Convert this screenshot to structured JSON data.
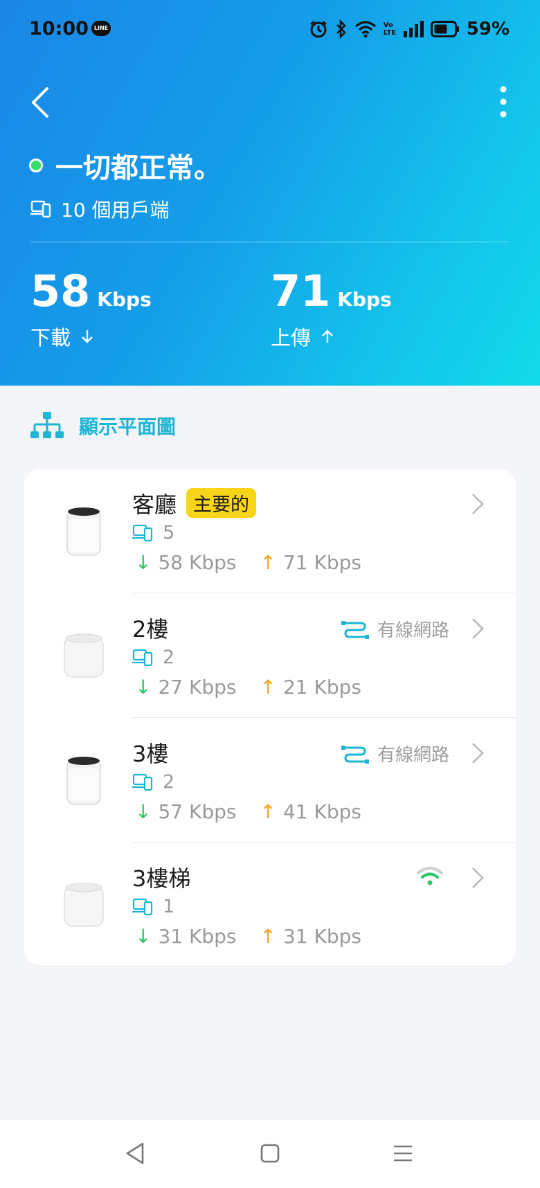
{
  "status_bar": {
    "time": "10:00",
    "line_label": "LINE",
    "volte_label": "Vo LTE",
    "battery_percent": "59%",
    "icons": [
      "line-app-icon",
      "alarm-icon",
      "bluetooth-icon",
      "wifi-icon",
      "volte-icon",
      "signal-icon",
      "battery-icon"
    ]
  },
  "header": {
    "status_message": "一切都正常。",
    "clients": "10 個用戶端",
    "download": {
      "value": "58",
      "unit": "Kbps",
      "label": "下載"
    },
    "upload": {
      "value": "71",
      "unit": "Kbps",
      "label": "上傳"
    }
  },
  "floor_plan": {
    "label": "顯示平面圖"
  },
  "devices": [
    {
      "name": "客廳",
      "badge": "主要的",
      "clients": "5",
      "down": "58 Kbps",
      "up": "71 Kbps",
      "connection": ""
    },
    {
      "name": "2樓",
      "clients": "2",
      "down": "27 Kbps",
      "up": "21 Kbps",
      "connection": "有線網路"
    },
    {
      "name": "3樓",
      "clients": "2",
      "down": "57 Kbps",
      "up": "41 Kbps",
      "connection": "有線網路"
    },
    {
      "name": "3樓梯",
      "clients": "1",
      "down": "31 Kbps",
      "up": "31 Kbps",
      "connection": "wifi"
    }
  ],
  "colors": {
    "accent": "#1cb6d4",
    "ok_green": "#33e06a",
    "down_green": "#2cc56a",
    "up_orange": "#f5a623",
    "badge_yellow": "#f9d51a"
  }
}
